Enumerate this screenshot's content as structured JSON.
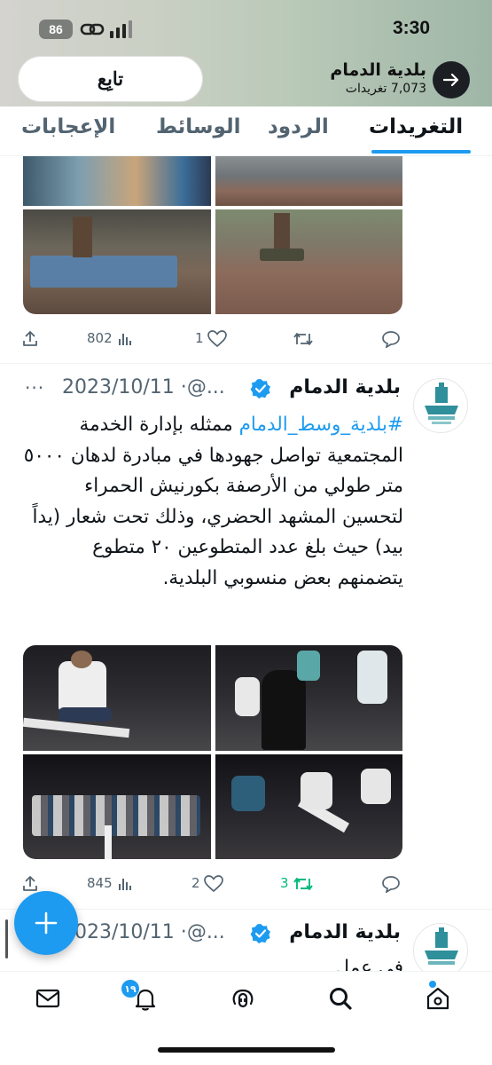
{
  "status_bar": {
    "time": "3:30",
    "battery": "86"
  },
  "profile_header": {
    "name": "بلدية الدمام",
    "tweet_count": "7,073 تغريدات",
    "follow_label": "تابِع"
  },
  "tabs": [
    {
      "label": "التغريدات",
      "active": true
    },
    {
      "label": "الردود",
      "active": false
    },
    {
      "label": "الوسائط",
      "active": false
    },
    {
      "label": "الإعجابات",
      "active": false
    }
  ],
  "tweet_prev": {
    "views": "802",
    "likes": "1",
    "retweets": "",
    "replies": ""
  },
  "tweet_main": {
    "name": "بلدية الدمام",
    "handle": "@...",
    "date": "2023/10/11",
    "hashtag": "#بلدية_وسط_الدمام",
    "text_rest": " ممثله بإدارة الخدمة المجتمعية تواصل جهودها في مبادرة لدهان ٥٠٠٠ متر طولي من الأرصفة بكورنيش الحمراء لتحسين المشهد الحضري، وذلك تحت شعار (يداً بيد) حيث بلغ عدد المتطوعين ٢٠ متطوع يتضمنهم بعض منسوبي البلدية.",
    "views": "845",
    "likes": "2",
    "retweets": "3",
    "replies": ""
  },
  "tweet_next": {
    "name": "بلدية الدمام",
    "handle": "@...",
    "date": "2023/10/11",
    "text_preview": "في عمل..."
  },
  "bottom_nav": {
    "notifications_badge": "١٩"
  },
  "colors": {
    "accent": "#1d9bf0",
    "retweet_green": "#00ba7c",
    "muted": "#536471"
  }
}
